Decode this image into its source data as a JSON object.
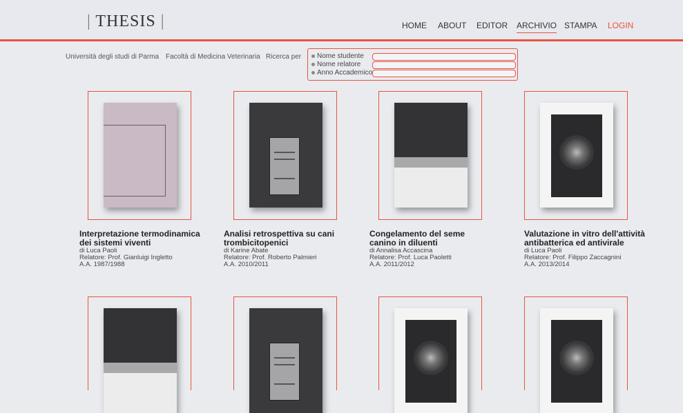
{
  "header": {
    "logo": "THESIS",
    "nav": [
      {
        "label": "HOME"
      },
      {
        "label": "ABOUT"
      },
      {
        "label": "EDITOR"
      },
      {
        "label": "ARCHIVIO"
      },
      {
        "label": "STAMPA"
      },
      {
        "label": "LOGIN"
      }
    ]
  },
  "filters": {
    "university": "Università degli studi di Parma",
    "faculty": "Facoltà di Medicina Veterinaria",
    "search_label": "Ricerca per",
    "options": [
      {
        "label": "Nome studente",
        "value": ""
      },
      {
        "label": "Nome relatore",
        "value": ""
      },
      {
        "label": "Anno Accademico",
        "value": ""
      }
    ]
  },
  "theses": [
    {
      "title_line1": "Interpretazione termodinamica",
      "title_line2": "dei sistemi viventi",
      "author": "di Luca Paoli",
      "advisor": "Relatore: Prof. Gianluigi Ingletto",
      "year": "A.A. 1987/1988"
    },
    {
      "title_line1": "Analisi retrospettiva su cani",
      "title_line2": "trombicitopenici",
      "author": "di Karine Abate",
      "advisor": "Relatore: Prof. Roberto Palmieri",
      "year": "A.A. 2010/2011"
    },
    {
      "title_line1": "Congelamento del seme",
      "title_line2": "canino in diluenti",
      "author": "di Annalisa Accascina",
      "advisor": "Relatore: Prof. Luca Paoletti",
      "year": "A.A. 2011/2012"
    },
    {
      "title_line1": "Valutazione in vitro dell'attività",
      "title_line2": "antibatterica ed antivirale",
      "author": "di Luca Paoli",
      "advisor": "Relatore: Prof. Filippo Zaccagnini",
      "year": "A.A. 2013/2014"
    }
  ],
  "colors": {
    "accent": "#e8533f",
    "background": "#e9ebef"
  }
}
